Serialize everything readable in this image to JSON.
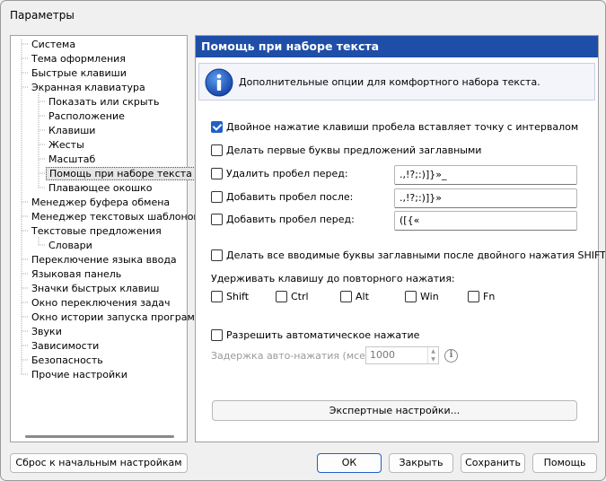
{
  "window": {
    "title": "Параметры"
  },
  "tree": {
    "items": [
      {
        "label": "Система",
        "level": 1
      },
      {
        "label": "Тема оформления",
        "level": 1
      },
      {
        "label": "Быстрые клавиши",
        "level": 1
      },
      {
        "label": "Экранная клавиатура",
        "level": 1
      },
      {
        "label": "Показать или скрыть",
        "level": 2
      },
      {
        "label": "Расположение",
        "level": 2
      },
      {
        "label": "Клавиши",
        "level": 2
      },
      {
        "label": "Жесты",
        "level": 2
      },
      {
        "label": "Масштаб",
        "level": 2
      },
      {
        "label": "Помощь при наборе текста",
        "level": 2,
        "selected": true
      },
      {
        "label": "Плавающее окошко",
        "level": 2
      },
      {
        "label": "Менеджер буфера обмена",
        "level": 1
      },
      {
        "label": "Менеджер текстовых шаблонов",
        "level": 1
      },
      {
        "label": "Текстовые предложения",
        "level": 1
      },
      {
        "label": "Словари",
        "level": 2
      },
      {
        "label": "Переключение языка ввода",
        "level": 1
      },
      {
        "label": "Языковая панель",
        "level": 1
      },
      {
        "label": "Значки быстрых клавиш",
        "level": 1
      },
      {
        "label": "Окно переключения задач",
        "level": 1
      },
      {
        "label": "Окно истории запуска программ",
        "level": 1
      },
      {
        "label": "Звуки",
        "level": 1
      },
      {
        "label": "Зависимости",
        "level": 1
      },
      {
        "label": "Безопасность",
        "level": 1
      },
      {
        "label": "Прочие настройки",
        "level": 1
      }
    ]
  },
  "panel": {
    "header": "Помощь при наборе текста",
    "info": "Дополнительные опции для комфортного набора текста.",
    "double_space": {
      "label": "Двойное нажатие клавиши пробела вставляет точку с интервалом",
      "checked": true
    },
    "capitalize_first": {
      "label": "Делать первые буквы предложений заглавными",
      "checked": false
    },
    "remove_space_before": {
      "label": "Удалить пробел перед:",
      "value": ".,!?;:)]}»_",
      "checked": false
    },
    "add_space_after": {
      "label": "Добавить пробел после:",
      "value": ".,!?;:)]}»",
      "checked": false
    },
    "add_space_before": {
      "label": "Добавить пробел перед:",
      "value": "([{«",
      "checked": false
    },
    "caps_after_shift": {
      "label": "Делать все вводимые буквы заглавными после двойного нажатия SHIFT",
      "checked": false
    },
    "hold_keys_label": "Удерживать клавишу до повторного нажатия:",
    "hold_keys": [
      "Shift",
      "Ctrl",
      "Alt",
      "Win",
      "Fn"
    ],
    "auto_press": {
      "label": "Разрешить автоматическое нажатие",
      "checked": false
    },
    "auto_delay": {
      "label": "Задержка авто-нажатия (мсек):",
      "value": "1000"
    },
    "hint_icon": "i",
    "expert_button": "Экспертные настройки..."
  },
  "footer": {
    "reset": "Сброс к начальным настройкам",
    "ok": "ОК",
    "close": "Закрыть",
    "save": "Сохранить",
    "help": "Помощь"
  },
  "colors": {
    "accent": "#1f5fc8",
    "header_bg": "#1e4ea8"
  }
}
